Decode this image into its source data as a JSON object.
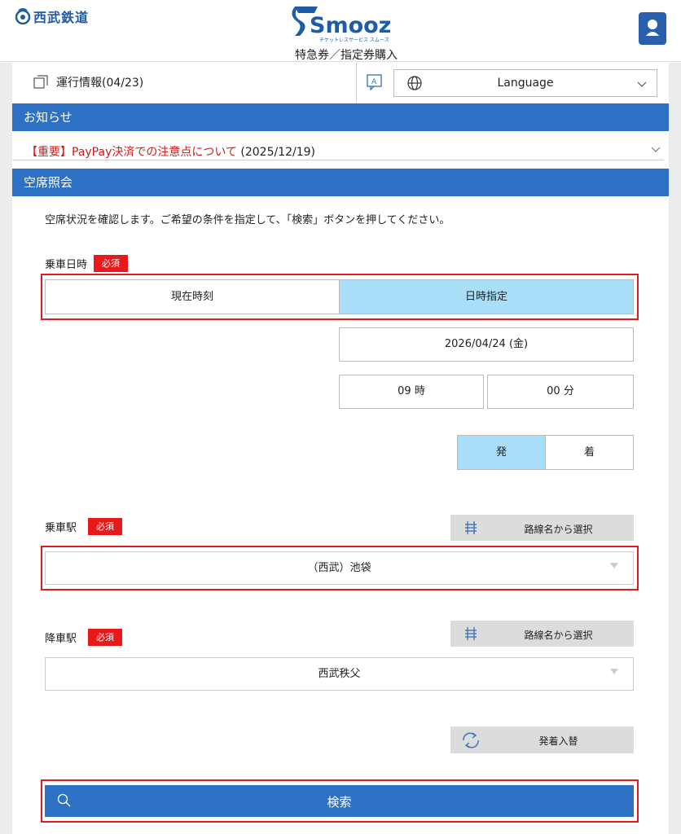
{
  "header": {
    "brand_name": "西武鉄道",
    "smooz_title": "Smooz",
    "smooz_tagline": "チケットレスサービス スムーズ",
    "page_subtitle": "特急券／指定券購入",
    "login_label": "ログイン",
    "brand_color": "#1f5ca8"
  },
  "info": {
    "operation_info": "運行情報(04/23)",
    "language_label": "Language"
  },
  "notices": {
    "section_title": "お知らせ",
    "item_label": "【重要】PayPay決済での注意点について",
    "item_date": "(2025/12/19)"
  },
  "search": {
    "section_title": "空席照会",
    "intro": "空席状況を確認します。ご希望の条件を指定して、「検索」ボタンを押してください。",
    "required_label": "必須",
    "boarding_datetime_label": "乗車日時",
    "now_label": "現在時刻",
    "specify_label": "日時指定",
    "date_value": "2026/04/24 (金)",
    "hour_value": "09 時",
    "minute_value": "00 分",
    "depart_label": "発",
    "arrive_label": "着",
    "from_station_label": "乗車駅",
    "from_station_value": "（西武）池袋",
    "to_station_label": "降車駅",
    "to_station_value": "西武秩父",
    "route_select_label": "路線名から選択",
    "swap_label": "発着入替",
    "search_button": "検索",
    "accent_color": "#2d71c4",
    "active_color": "#a9def8",
    "required_color": "#e8191b"
  }
}
